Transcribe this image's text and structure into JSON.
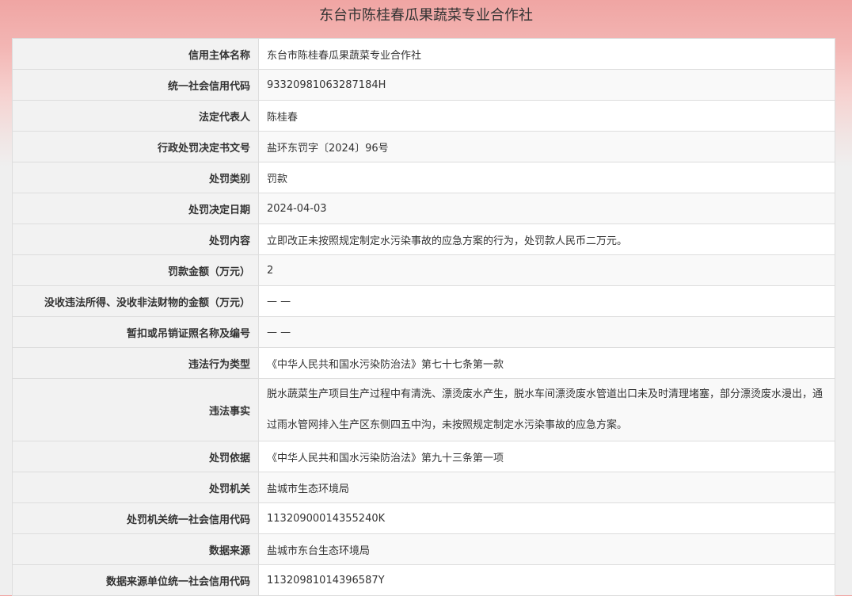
{
  "page": {
    "title": "东台市陈桂春瓜果蔬菜专业合作社"
  },
  "rows": [
    {
      "label": "信用主体名称",
      "value": "东台市陈桂春瓜果蔬菜专业合作社"
    },
    {
      "label": "统一社会信用代码",
      "value": "93320981063287184H"
    },
    {
      "label": "法定代表人",
      "value": "陈桂春"
    },
    {
      "label": "行政处罚决定书文号",
      "value": "盐环东罚字〔2024〕96号"
    },
    {
      "label": "处罚类别",
      "value": "罚款"
    },
    {
      "label": "处罚决定日期",
      "value": "2024-04-03"
    },
    {
      "label": "处罚内容",
      "value": "立即改正未按照规定制定水污染事故的应急方案的行为，处罚款人民币二万元。"
    },
    {
      "label": "罚款金额（万元）",
      "value": "2"
    },
    {
      "label": "没收违法所得、没收非法财物的金额（万元）",
      "value": "— —"
    },
    {
      "label": "暂扣或吊销证照名称及编号",
      "value": "— —"
    },
    {
      "label": "违法行为类型",
      "value": "《中华人民共和国水污染防治法》第七十七条第一款"
    },
    {
      "label": "违法事实",
      "value": "脱水蔬菜生产项目生产过程中有清洗、漂烫废水产生，脱水车间漂烫废水管道出口未及时清理堵塞，部分漂烫废水漫出，通过雨水管网排入生产区东侧四五中沟，未按照规定制定水污染事故的应急方案。"
    },
    {
      "label": "处罚依据",
      "value": "《中华人民共和国水污染防治法》第九十三条第一项"
    },
    {
      "label": "处罚机关",
      "value": "盐城市生态环境局"
    },
    {
      "label": "处罚机关统一社会信用代码",
      "value": "11320900014355240K"
    },
    {
      "label": "数据来源",
      "value": "盐城市东台生态环境局"
    },
    {
      "label": "数据来源单位统一社会信用代码",
      "value": "11320981014396587Y"
    }
  ]
}
